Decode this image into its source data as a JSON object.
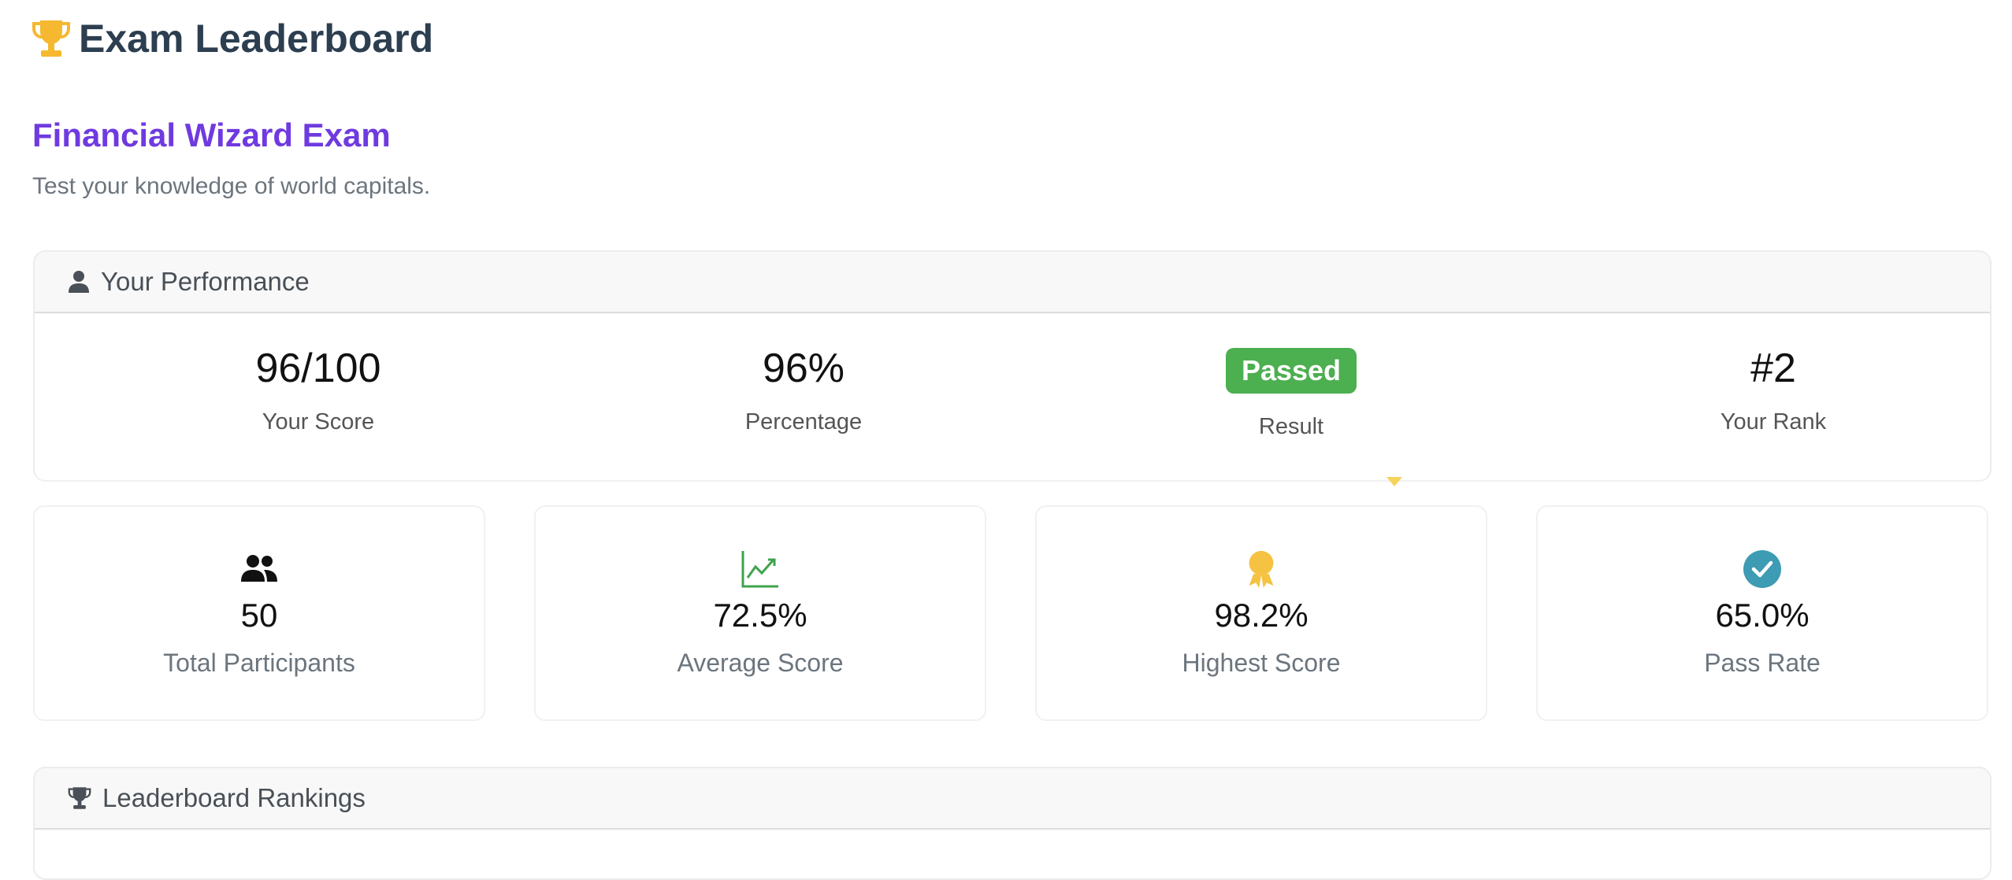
{
  "app": {
    "title": "Exam Leaderboard"
  },
  "exam": {
    "title": "Financial Wizard Exam",
    "description": "Test your knowledge of world capitals."
  },
  "performance": {
    "header": "Your Performance",
    "score": {
      "value": "96/100",
      "label": "Your Score"
    },
    "percentage": {
      "value": "96%",
      "label": "Percentage"
    },
    "result": {
      "value": "Passed",
      "label": "Result"
    },
    "rank": {
      "value": "#2",
      "label": "Your Rank"
    }
  },
  "stats": [
    {
      "icon": "users-icon",
      "value": "50",
      "label": "Total Participants"
    },
    {
      "icon": "line-chart-icon",
      "value": "72.5%",
      "label": "Average Score"
    },
    {
      "icon": "award-icon",
      "value": "98.2%",
      "label": "Highest Score"
    },
    {
      "icon": "check-circle-icon",
      "value": "65.0%",
      "label": "Pass Rate"
    }
  ],
  "leaderboard": {
    "header": "Leaderboard Rankings"
  },
  "colors": {
    "accent_purple": "#6f3ae0",
    "title_dark": "#2c3e50",
    "trophy_gold": "#f5b82e",
    "passed_green": "#4caf50",
    "chart_green": "#3fa34d",
    "check_teal": "#3d9bb3"
  }
}
